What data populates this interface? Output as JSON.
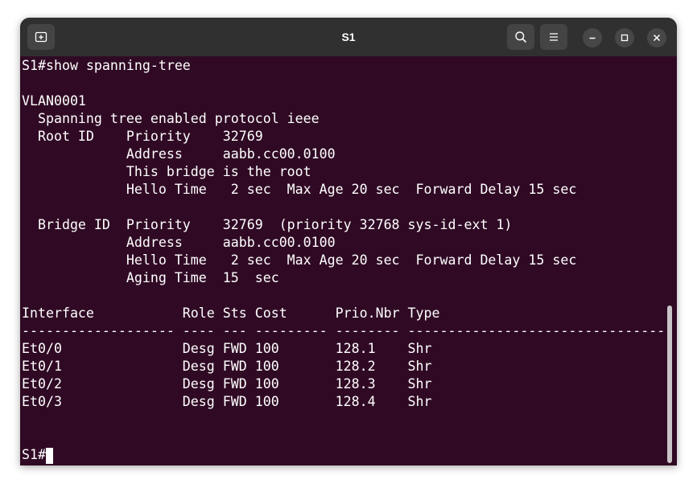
{
  "window": {
    "title": "S1"
  },
  "titlebar": {
    "new_tab_icon": "new-tab-icon",
    "search_icon": "search-icon",
    "menu_icon": "hamburger-menu-icon",
    "minimize_icon": "minimize-icon",
    "maximize_icon": "maximize-icon",
    "close_icon": "close-icon"
  },
  "colors": {
    "terminal_bg": "#300a24",
    "titlebar_bg": "#303030",
    "text": "#ffffff"
  },
  "terminal": {
    "lines": [
      "S1#show spanning-tree",
      "",
      "VLAN0001",
      "  Spanning tree enabled protocol ieee",
      "  Root ID    Priority    32769",
      "             Address     aabb.cc00.0100",
      "             This bridge is the root",
      "             Hello Time   2 sec  Max Age 20 sec  Forward Delay 15 sec",
      "",
      "  Bridge ID  Priority    32769  (priority 32768 sys-id-ext 1)",
      "             Address     aabb.cc00.0100",
      "             Hello Time   2 sec  Max Age 20 sec  Forward Delay 15 sec",
      "             Aging Time  15  sec",
      "",
      "Interface           Role Sts Cost      Prio.Nbr Type",
      "------------------- ---- --- --------- -------- --------------------------------",
      "Et0/0               Desg FWD 100       128.1    Shr",
      "Et0/1               Desg FWD 100       128.2    Shr",
      "Et0/2               Desg FWD 100       128.3    Shr",
      "Et0/3               Desg FWD 100       128.4    Shr"
    ],
    "prompt": "S1#"
  }
}
